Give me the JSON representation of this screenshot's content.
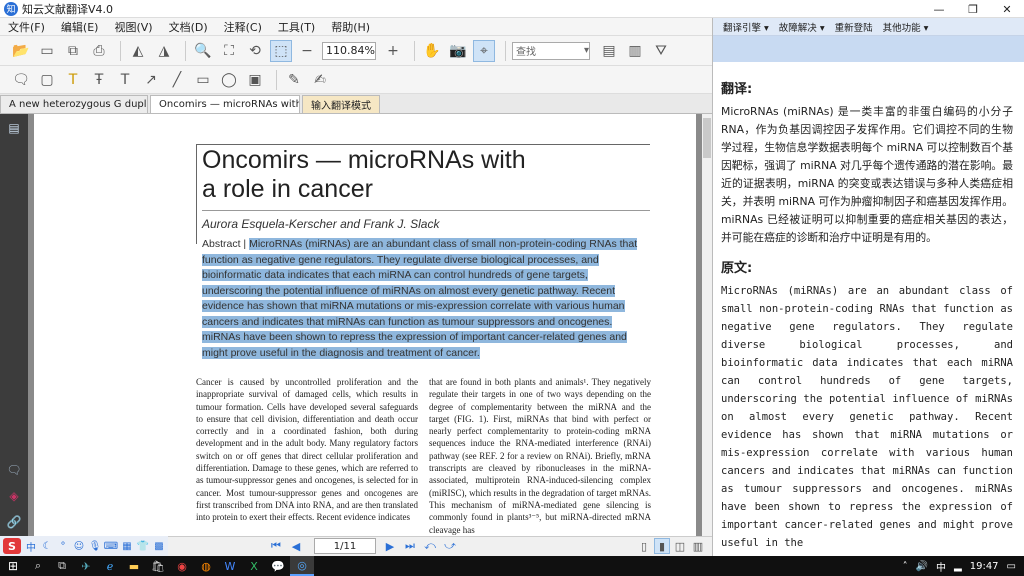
{
  "window": {
    "title": "知云文献翻译V4.0",
    "minimize": "—",
    "maximize": "❐",
    "close": "✕"
  },
  "menu": [
    "文件(F)",
    "编辑(E)",
    "视图(V)",
    "文档(D)",
    "注释(C)",
    "工具(T)",
    "帮助(H)"
  ],
  "toolbar": {
    "zoom": "110.84%",
    "search_placeholder": "查找"
  },
  "tabs": [
    {
      "label": "A new heterozygous G duplic..."
    },
    {
      "label": "Oncomirs — microRNAs with",
      "close": "✕"
    },
    {
      "label": "输入翻译模式"
    }
  ],
  "paper": {
    "title_line1": "Oncomirs — microRNAs with",
    "title_line2": "a role in cancer",
    "authors": "Aurora Esquela-Kerscher and Frank J. Slack",
    "abstract_label": "Abstract | ",
    "abstract": "MicroRNAs (miRNAs) are an abundant class of small non-protein-coding RNAs that function as negative gene regulators. They regulate diverse biological processes, and bioinformatic data indicates that each miRNA can control hundreds of gene targets, underscoring the potential influence of miRNAs on almost every genetic pathway. Recent evidence has shown that miRNA mutations or mis-expression correlate with various human cancers and indicates that miRNAs can function as tumour suppressors and oncogenes. miRNAs have been shown to repress the expression of important cancer-related genes and might prove useful in the diagnosis and treatment of cancer.",
    "col1": "Cancer is caused by uncontrolled proliferation and the inappropriate survival of damaged cells, which results in tumour formation. Cells have developed several safeguards to ensure that cell division, differentiation and death occur correctly and in a coordinated fashion, both during development and in the adult body. Many regulatory factors switch on or off genes that direct cellular proliferation and differentiation. Damage to these genes, which are referred to as tumour-suppressor genes and oncogenes, is selected for in cancer. Most tumour-suppressor genes and oncogenes are first transcribed from DNA into RNA, and are then translated into protein to exert their effects. Recent evidence indicates",
    "col2": "that are found in both plants and animals¹. They negatively regulate their targets in one of two ways depending on the degree of complementarity between the miRNA and the target (FIG. 1). First, miRNAs that bind with perfect or nearly perfect complementarity to protein-coding mRNA sequences induce the RNA-mediated interference (RNAi) pathway (see REF. 2 for a review on RNAi). Briefly, mRNA transcripts are cleaved by ribonucleases in the miRNA-associated, multiprotein RNA-induced-silencing complex (miRISC), which results in the degradation of target mRNAs. This mechanism of miRNA-mediated gene silencing is commonly found in plants³⁻⁵, but miRNA-directed mRNA cleavage has"
  },
  "navigation": {
    "page": "1/11"
  },
  "right_panel": {
    "menu": [
      "翻译引擎 ▾",
      "故障解决 ▾",
      "重新登陆",
      "其他功能 ▾"
    ],
    "translation_heading": "翻译:",
    "translation": "MicroRNAs (miRNAs) 是一类丰富的非蛋白编码的小分子 RNA，作为负基因调控因子发挥作用。它们调控不同的生物学过程，生物信息学数据表明每个 miRNA 可以控制数百个基因靶标，强调了 miRNA 对几乎每个遗传通路的潜在影响。最近的证据表明，miRNA 的突变或表达错误与多种人类癌症相关，并表明 miRNA 可作为肿瘤抑制因子和癌基因发挥作用。miRNAs 已经被证明可以抑制重要的癌症相关基因的表达，并可能在癌症的诊断和治疗中证明是有用的。",
    "original_heading": "原文:",
    "original": "MicroRNAs (miRNAs) are an abundant class of small non-protein-coding RNAs that function as negative gene regulators. They regulate diverse biological processes, and bioinformatic data indicates that each miRNA can control hundreds of gene targets, underscoring the potential influence of miRNAs on almost every genetic pathway. Recent evidence has shown that miRNA mutations or mis-expression correlate with various human cancers and indicates that miRNAs can function as tumour suppressors and oncogenes. miRNAs have been shown to repress the expression of important cancer-related genes and might prove useful in the"
  },
  "ime": {
    "logo": "S",
    "mode": "中"
  },
  "taskbar": {
    "time": "19:47",
    "lang": "中"
  },
  "colors": {
    "highlight": "#8fb7dd",
    "accent": "#2a6fd6"
  }
}
